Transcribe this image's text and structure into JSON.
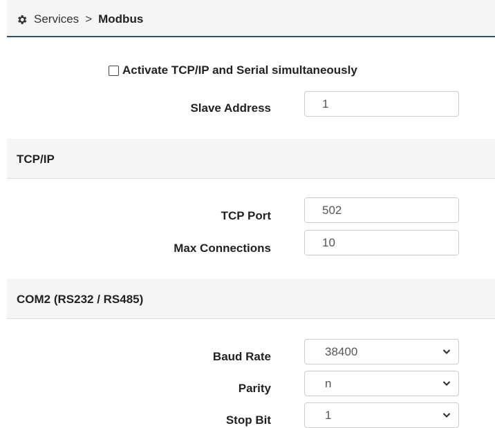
{
  "breadcrumb": {
    "parent": "Services",
    "separator": ">",
    "current": "Modbus"
  },
  "general": {
    "simultaneous_label": "Activate TCP/IP and Serial simultaneously",
    "simultaneous_checked": false,
    "slave_address_label": "Slave Address",
    "slave_address_value": "1"
  },
  "tcp": {
    "title": "TCP/IP",
    "port_label": "TCP Port",
    "port_value": "502",
    "max_conn_label": "Max Connections",
    "max_conn_value": "10"
  },
  "serial": {
    "title": "COM2 (RS232 / RS485)",
    "baud_label": "Baud Rate",
    "baud_value": "38400",
    "parity_label": "Parity",
    "parity_value": "n",
    "stopbit_label": "Stop Bit",
    "stopbit_value": "1"
  }
}
